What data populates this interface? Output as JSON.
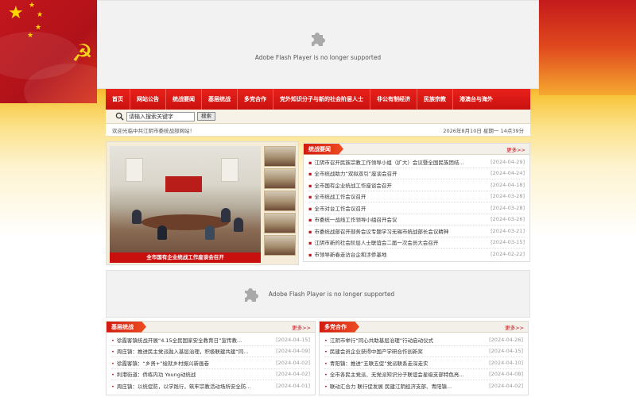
{
  "flash_top": {
    "message": "Adobe Flash Player is no longer supported"
  },
  "flash_mid": {
    "message": "Adobe Flash Player is no longer supported"
  },
  "nav": [
    "首页",
    "网站公告",
    "统战要闻",
    "基层统战",
    "多党合作",
    "党外知识分子与新的社会阶层人士",
    "非公有制经济",
    "民族宗教",
    "港澳台与海外"
  ],
  "search": {
    "value": "请输入搜索关键字",
    "button": "搜索"
  },
  "welcome": {
    "text": "欢迎光临中共江阴市委统战部网站！",
    "datetime": "2026年8月10日 星期一 14点39分"
  },
  "slide": {
    "caption": "全市国有企业统战工作座谈会召开"
  },
  "news": {
    "title": "统战要闻",
    "more": "更多>>",
    "items": [
      {
        "title": "江阴市召开民族宗教工作领导小组（扩大）会议暨全国民族团结...",
        "date": "[2024-04-29]"
      },
      {
        "title": "全市统战助力“双拟双引”座谈会召开",
        "date": "[2024-04-24]"
      },
      {
        "title": "全市国有企业统战工作座谈会召开",
        "date": "[2024-04-18]"
      },
      {
        "title": "全市统战工作会议召开",
        "date": "[2024-03-28]"
      },
      {
        "title": "全市对台工作会议召开",
        "date": "[2024-03-28]"
      },
      {
        "title": "市委统一战线工作领导小组召开会议",
        "date": "[2024-03-26]"
      },
      {
        "title": "市委统战部召开部务会议专题学习无锡市统战部长会议精神",
        "date": "[2024-03-21]"
      },
      {
        "title": "江阴市新的社会阶层人士联谊会二届一次会员大会召开",
        "date": "[2024-03-15]"
      },
      {
        "title": "市领导新春走访台企和涉侨基地",
        "date": "[2024-02-22]"
      }
    ]
  },
  "grassroots": {
    "title": "基层统战",
    "more": "更多>>",
    "items": [
      {
        "title": "徐霞客镇统战开展“4.15全民国家安全教育日”宣传教...",
        "date": "[2024-04-15]"
      },
      {
        "title": "周庄镇：推进民主党派融入基层治理，积极联建共建“同...",
        "date": "[2024-04-09]"
      },
      {
        "title": "徐霞客镇：“乡贤+”绘就乡村振兴新画卷",
        "date": "[2024-04-02]"
      },
      {
        "title": "利港街道：侨练内功 Young动统战",
        "date": "[2024-04-02]"
      },
      {
        "title": "周庄镇：以统促防，以学践行，筑牢宗教活动场所安全防...",
        "date": "[2024-04-01]"
      }
    ]
  },
  "multiparty": {
    "title": "多党合作",
    "more": "更多>>",
    "items": [
      {
        "title": "江阴市举行“同心共助基层治理”行动启动仪式",
        "date": "[2024-04-26]"
      },
      {
        "title": "民建会员企业获得中国产学研合作创新奖",
        "date": "[2024-04-15]"
      },
      {
        "title": "青阳镇：推进“五联五促”党派联系走深走实",
        "date": "[2024-04-10]"
      },
      {
        "title": "全市各民主党派、无党派知识分子联谊会星级支部特色亮...",
        "date": "[2024-04-08]"
      },
      {
        "title": "联动汇合力 联行促发展 民建江阴经济支部、青阳镇...",
        "date": "[2024-04-02]"
      }
    ]
  }
}
